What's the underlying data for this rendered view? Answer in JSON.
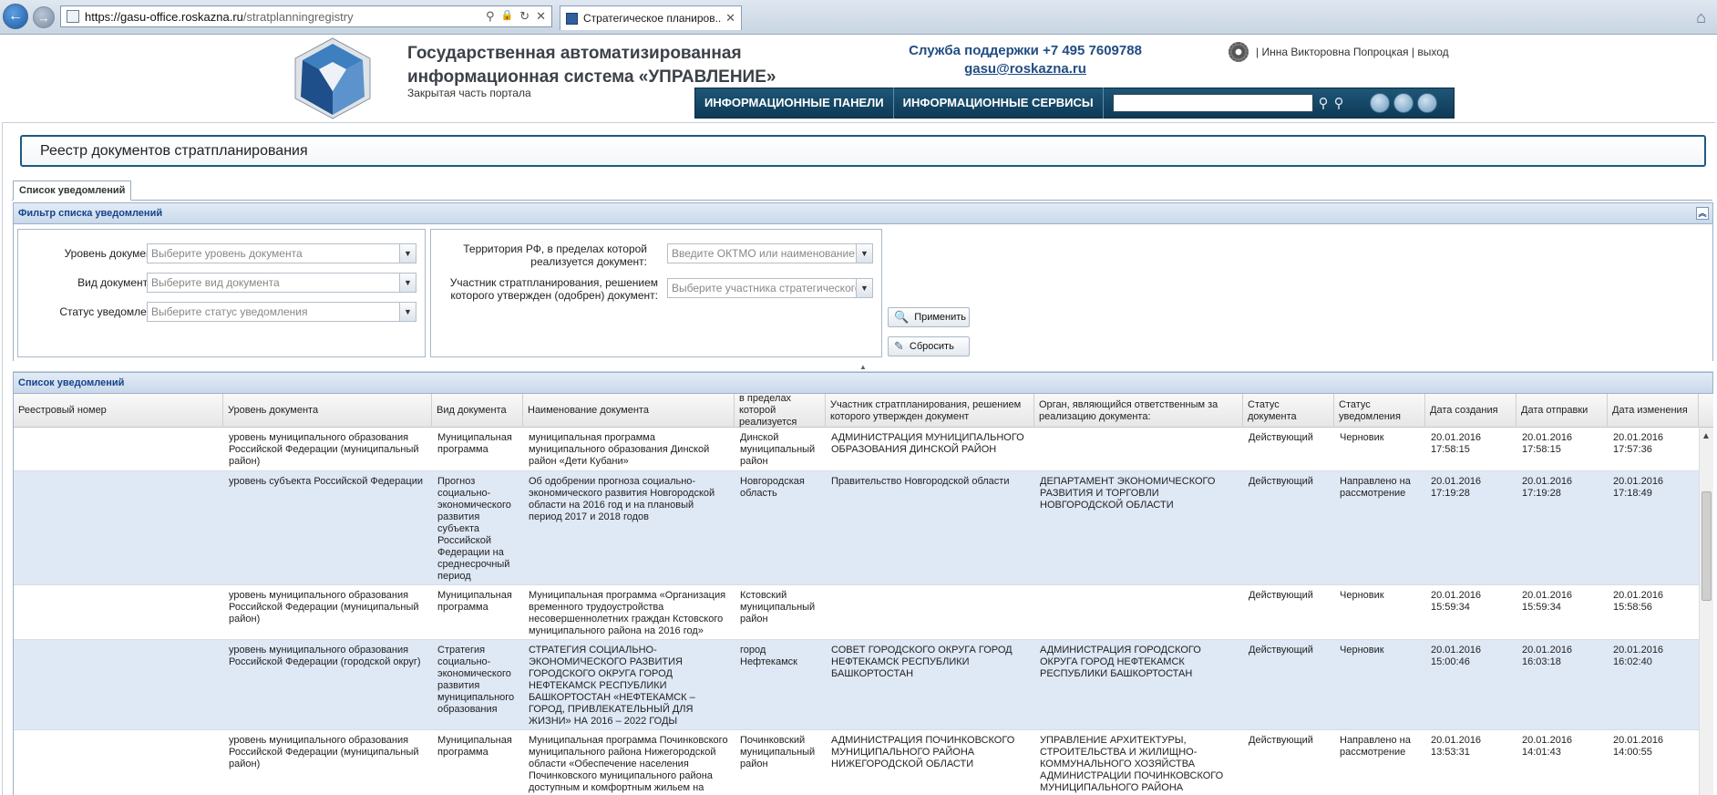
{
  "browser": {
    "url_host": "https://gasu-office.roskazna.ru",
    "url_path": "/stratplanningregistry",
    "tab_title": "Стратегическое планиров...",
    "tab_close": "✕",
    "back_icon": "←",
    "forward_icon": "→",
    "home_icon": "⌂",
    "search_icon": "⚲",
    "lock_icon": "🔒",
    "refresh_icon": "↻",
    "stop_icon": "✕"
  },
  "header": {
    "title_line1": "Государственная автоматизированная",
    "title_line2": "информационная система «УПРАВЛЕНИЕ»",
    "subtitle": "Закрытая часть портала",
    "support_phone": "Служба поддержки +7 495 7609788",
    "support_email": "gasu@roskazna.ru",
    "user_name": "Инна Викторовна Попроцкая",
    "sep1": "|",
    "sep2": "|",
    "logout": "выход"
  },
  "menu": {
    "item1": "ИНФОРМАЦИОННЫЕ ПАНЕЛИ",
    "item2": "ИНФОРМАЦИОННЫЕ СЕРВИСЫ",
    "search_icon": "⚲",
    "adv_search_icon": "⚲"
  },
  "page": {
    "title": "Реестр документов стратпланирования",
    "tab": "Список уведомлений"
  },
  "filter": {
    "header": "Фильтр списка уведомлений",
    "collapse_icon": "︽",
    "level_label": "Уровень документа:",
    "level_placeholder": "Выберите уровень документа",
    "type_label": "Вид документа:",
    "type_placeholder": "Выберите вид документа",
    "status_label": "Статус уведомления:",
    "status_placeholder": "Выберите статус уведомления",
    "territory_label": "Территория РФ, в пределах которой реализуется документ:",
    "territory_placeholder": "Введите ОКТМО или наименование д",
    "participant_label": "Участник стратпланирования, решением которого утвержден (одобрен) документ:",
    "participant_placeholder": "Выберите участника стратегического",
    "apply_button": "Применить",
    "reset_button": "Сбросить",
    "apply_icon": "🔍",
    "reset_icon": "✎",
    "combo_arrow": "▼",
    "splitter_icon": "▲"
  },
  "list": {
    "header": "Список уведомлений",
    "columns": [
      "Реестровый номер",
      "Уровень документа",
      "Вид документа",
      "Наименование документа",
      "Территория РФ, в пределах которой реализуется документ",
      "Участник стратпланирования, решением которого утвержден документ",
      "Орган, являющийся ответственным за реализацию документа:",
      "Статус документа",
      "Статус уведомления",
      "Дата создания",
      "Дата отправки",
      "Дата изменения"
    ],
    "rows": [
      {
        "reg": "",
        "level": "уровень муниципального образования Российской Федерации (муниципальный район)",
        "kind": "Муниципальная программа",
        "name": "муниципальная программа муниципального образования Динской район «Дети Кубани»",
        "territory": "Динской муниципальный район",
        "participant": "АДМИНИСТРАЦИЯ МУНИЦИПАЛЬНОГО ОБРАЗОВАНИЯ ДИНСКОЙ РАЙОН",
        "organ": "",
        "doc_status": "Действующий",
        "notif_status": "Черновик",
        "created": "20.01.2016 17:58:15",
        "sent": "20.01.2016 17:58:15",
        "changed": "20.01.2016 17:57:36"
      },
      {
        "reg": "",
        "level": "уровень субъекта Российской Федерации",
        "kind": "Прогноз социально-экономического развития субъекта Российской Федерации на среднесрочный период",
        "name": "Об одобрении прогноза социально-экономического развития Новгородской области на 2016 год и на плановый период 2017 и 2018 годов",
        "territory": "Новгородская область",
        "participant": "Правительство Новгородской области",
        "organ": "ДЕПАРТАМЕНТ ЭКОНОМИЧЕСКОГО РАЗВИТИЯ И ТОРГОВЛИ НОВГОРОДСКОЙ ОБЛАСТИ",
        "doc_status": "Действующий",
        "notif_status": "Направлено на рассмотрение",
        "created": "20.01.2016 17:19:28",
        "sent": "20.01.2016 17:19:28",
        "changed": "20.01.2016 17:18:49"
      },
      {
        "reg": "",
        "level": "уровень муниципального образования Российской Федерации (муниципальный район)",
        "kind": "Муниципальная программа",
        "name": "Муниципальная программа «Организация временного трудоустройства несовершеннолетних граждан Кстовского муниципального района на 2016 год»",
        "territory": "Кстовский муниципальный район",
        "participant": "",
        "organ": "",
        "doc_status": "Действующий",
        "notif_status": "Черновик",
        "created": "20.01.2016 15:59:34",
        "sent": "20.01.2016 15:59:34",
        "changed": "20.01.2016 15:58:56"
      },
      {
        "reg": "",
        "level": "уровень муниципального образования Российской Федерации (городской округ)",
        "kind": "Стратегия социально-экономического развития муниципального образования",
        "name": "СТРАТЕГИЯ СОЦИАЛЬНО-ЭКОНОМИЧЕСКОГО РАЗВИТИЯ ГОРОДСКОГО ОКРУГА ГОРОД НЕФТЕКАМСК РЕСПУБЛИКИ БАШКОРТОСТАН «НЕФТЕКАМСК – ГОРОД, ПРИВЛЕКАТЕЛЬНЫЙ ДЛЯ ЖИЗНИ» НА 2016 – 2022 ГОДЫ",
        "territory": "город Нефтекамск",
        "participant": "СОВЕТ ГОРОДСКОГО ОКРУГА ГОРОД НЕФТЕКАМСК РЕСПУБЛИКИ БАШКОРТОСТАН",
        "organ": "АДМИНИСТРАЦИЯ ГОРОДСКОГО ОКРУГА ГОРОД НЕФТЕКАМСК РЕСПУБЛИКИ БАШКОРТОСТАН",
        "doc_status": "Действующий",
        "notif_status": "Черновик",
        "created": "20.01.2016 15:00:46",
        "sent": "20.01.2016 16:03:18",
        "changed": "20.01.2016 16:02:40"
      },
      {
        "reg": "",
        "level": "уровень муниципального образования Российской Федерации (муниципальный район)",
        "kind": "Муниципальная программа",
        "name": "Муниципальная программа Починковского муниципального района Нижегородской области «Обеспечение населения Починковского муниципального района доступным и комфортным жильем на",
        "territory": "Починковский муниципальный район",
        "participant": "АДМИНИСТРАЦИЯ ПОЧИНКОВСКОГО МУНИЦИПАЛЬНОГО РАЙОНА НИЖЕГОРОДСКОЙ ОБЛАСТИ",
        "organ": "УПРАВЛЕНИЕ АРХИТЕКТУРЫ, СТРОИТЕЛЬСТВА И ЖИЛИЩНО-КОММУНАЛЬНОГО ХОЗЯЙСТВА АДМИНИСТРАЦИИ ПОЧИНКОВСКОГО МУНИЦИПАЛЬНОГО РАЙОНА",
        "doc_status": "Действующий",
        "notif_status": "Направлено на рассмотрение",
        "created": "20.01.2016 13:53:31",
        "sent": "20.01.2016 14:01:43",
        "changed": "20.01.2016 14:00:55"
      }
    ]
  }
}
